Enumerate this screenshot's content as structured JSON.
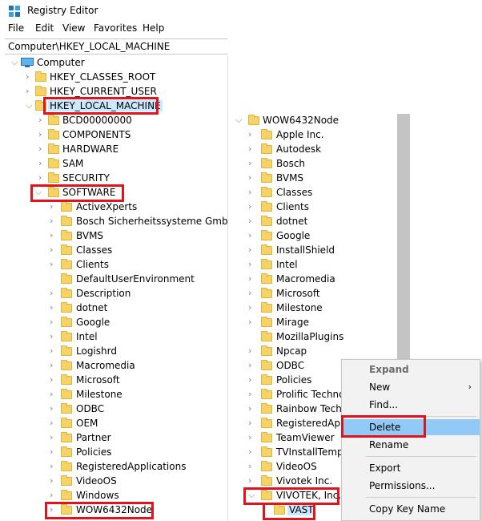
{
  "window": {
    "title": "Registry Editor"
  },
  "menu": [
    "File",
    "Edit",
    "View",
    "Favorites",
    "Help"
  ],
  "address": "Computer\\HKEY_LOCAL_MACHINE",
  "left_tree": {
    "root": "Computer",
    "hives": [
      "HKEY_CLASSES_ROOT",
      "HKEY_CURRENT_USER",
      "HKEY_LOCAL_MACHINE"
    ],
    "hklm_children": [
      "BCD00000000",
      "COMPONENTS",
      "HARDWARE",
      "SAM",
      "SECURITY",
      "SOFTWARE"
    ],
    "software_children": [
      "ActiveXperts",
      "Bosch Sicherheitssysteme GmbH",
      "BVMS",
      "Classes",
      "Clients",
      "DefaultUserEnvironment",
      "Description",
      "dotnet",
      "Google",
      "Intel",
      "Logishrd",
      "Macromedia",
      "Microsoft",
      "Milestone",
      "ODBC",
      "OEM",
      "Partner",
      "Policies",
      "RegisteredApplications",
      "VideoOS",
      "Windows",
      "WOW6432Node"
    ]
  },
  "right_tree": {
    "root": "WOW6432Node",
    "children": [
      "Apple Inc.",
      "Autodesk",
      "Bosch",
      "BVMS",
      "Classes",
      "Clients",
      "dotnet",
      "Google",
      "InstallShield",
      "Intel",
      "Macromedia",
      "Microsoft",
      "Milestone",
      "Mirage",
      "MozillaPlugins",
      "Npcap",
      "ODBC",
      "Policies",
      "Prolific Technol",
      "Rainbow Techn",
      "RegisteredAppl",
      "TeamViewer",
      "TVInstallTemp",
      "VideoOS",
      "Vivotek Inc.",
      "VIVOTEK, Inc."
    ],
    "selected_child": "VAST"
  },
  "context_menu": {
    "expand": "Expand",
    "new": "New",
    "find": "Find...",
    "delete": "Delete",
    "rename": "Rename",
    "export": "Export",
    "permissions": "Permissions...",
    "copy_key_name": "Copy Key Name"
  },
  "colors": {
    "highlight_box": "#e1141e",
    "selection": "#cce8ff",
    "folder": "#f6d366"
  }
}
